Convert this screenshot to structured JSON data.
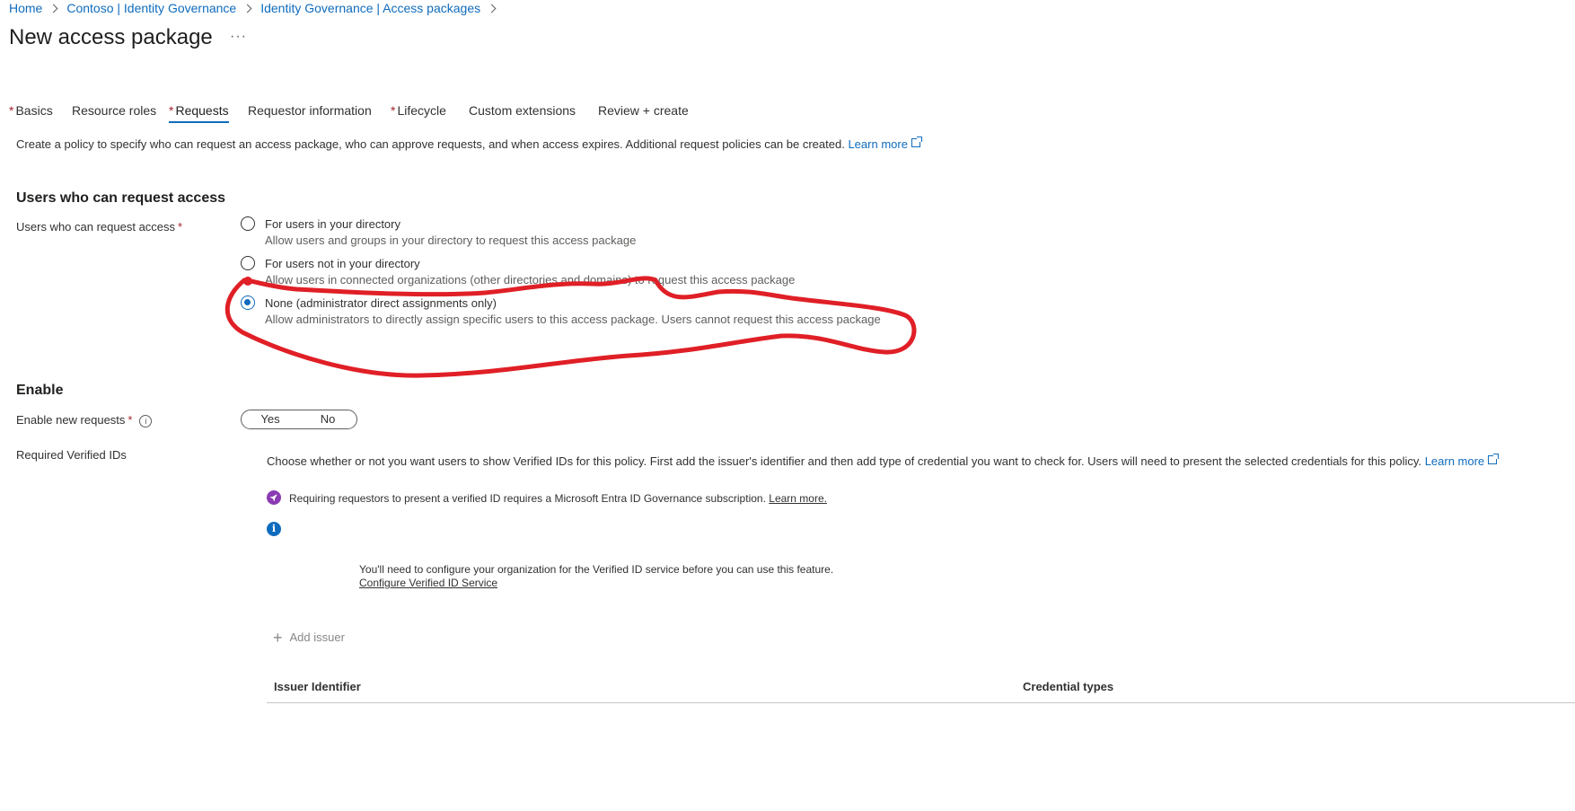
{
  "breadcrumb": [
    "Home",
    "Contoso | Identity Governance",
    "Identity Governance | Access packages"
  ],
  "page_title": "New access package",
  "more_label": "···",
  "tabs": [
    {
      "label": "Basics",
      "required": "*"
    },
    {
      "label": "Resource roles",
      "required": ""
    },
    {
      "label": "Requests",
      "required": "*"
    },
    {
      "label": "Requestor information",
      "required": ""
    },
    {
      "label": "Lifecycle",
      "required": "*"
    },
    {
      "label": "Custom extensions",
      "required": ""
    },
    {
      "label": "Review + create",
      "required": ""
    }
  ],
  "active_tab": "Requests",
  "description": {
    "text": "Create a policy to specify who can request an access package, who can approve requests, and when access expires. Additional request policies can be created.",
    "link": "Learn more"
  },
  "users_section": {
    "heading": "Users who can request access",
    "field_label": "Users who can request access",
    "required": "*",
    "options": [
      {
        "title": "For users in your directory",
        "desc": "Allow users and groups in your directory to request this access package",
        "checked": false
      },
      {
        "title": "For users not in your directory",
        "desc": "Allow users in connected organizations (other directories and domains) to request this access package",
        "checked": false
      },
      {
        "title": "None (administrator direct assignments only)",
        "desc": "Allow administrators to directly assign specific users to this access package. Users cannot request this access package",
        "checked": true
      }
    ]
  },
  "enable_section": {
    "heading": "Enable",
    "enable_label": "Enable new requests",
    "required": "*",
    "info_glyph": "i",
    "toggle": {
      "yes": "Yes",
      "no": "No"
    },
    "verified_label": "Required Verified IDs",
    "verified_desc": "Choose whether or not you want users to show Verified IDs for this policy. First add the issuer's identifier and then add type of credential you want to check for. Users will need to present the selected credentials for this policy.",
    "verified_link": "Learn more",
    "subscription_notice": "Requiring requestors to present a verified ID requires a Microsoft Entra ID Governance subscription.",
    "subscription_link": "Learn more.",
    "info_icon_glyph": "i",
    "configure_notice": "You'll need to configure your organization for the Verified ID service before you can use this feature.",
    "configure_link": "Configure Verified ID Service",
    "add_issuer": "Add issuer",
    "plus_glyph": "+",
    "table_headers": [
      "Issuer Identifier",
      "Credential types"
    ]
  },
  "colors": {
    "accent": "#0f6cbd",
    "required": "#a4262c",
    "annotation": "#e01f26",
    "rocket": "#8a3bb3"
  }
}
